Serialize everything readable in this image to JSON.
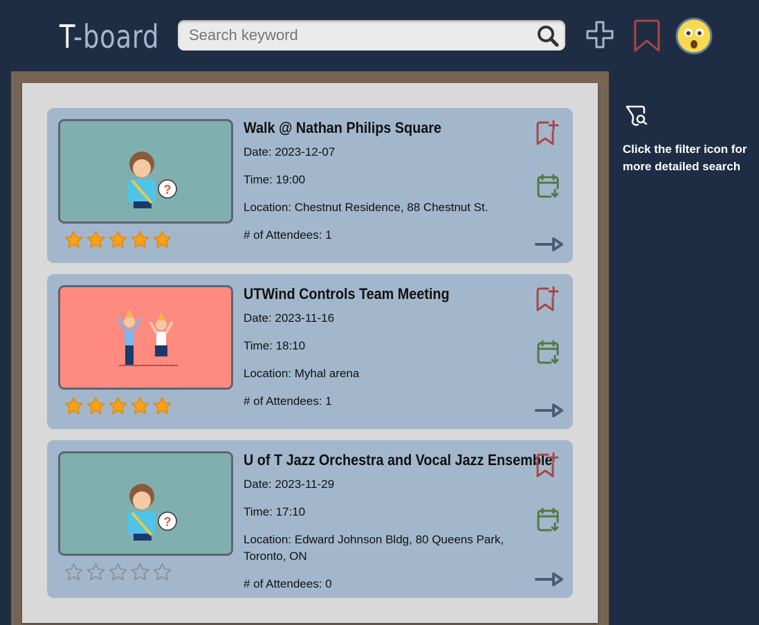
{
  "header": {
    "logo_prefix": "T",
    "logo_rest": "-board",
    "search_placeholder": "Search keyword"
  },
  "sidebar": {
    "hint": "Click the filter icon for more detailed search"
  },
  "labels": {
    "date": "Date: ",
    "time": "Time: ",
    "location": "Location: ",
    "attendees": "# of Attendees: "
  },
  "events": [
    {
      "title": "Walk @ Nathan Philips Square",
      "date": "2023-12-07",
      "time": "19:00",
      "location": "Chestnut Residence, 88 Chestnut St.",
      "attendees": "1",
      "rating": 5,
      "image_bg": "#7fafaf",
      "image": "confused-person"
    },
    {
      "title": "UTWind Controls Team Meeting",
      "date": "2023-11-16",
      "time": "18:10",
      "location": "Myhal arena",
      "attendees": "1",
      "rating": 5,
      "image_bg": "#ff8a80",
      "image": "party-people"
    },
    {
      "title": "U of T Jazz Orchestra and Vocal Jazz Ensemble",
      "date": "2023-11-29",
      "time": "17:10",
      "location": "Edward Johnson Bldg, 80 Queens Park, Toronto, ON",
      "attendees": "0",
      "rating": 0,
      "image_bg": "#7fafaf",
      "image": "confused-person"
    }
  ]
}
